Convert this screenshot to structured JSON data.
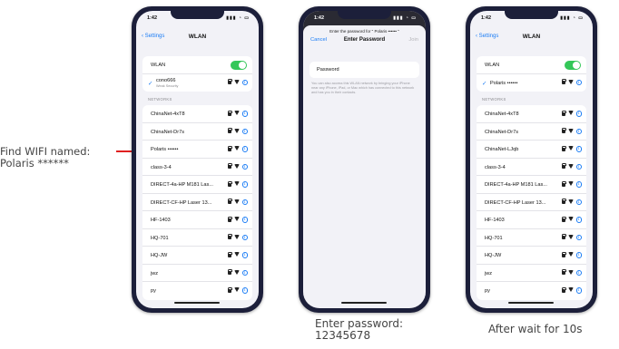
{
  "annotations": {
    "find_wifi": "Find WIFI named: Polaris ******",
    "enter_password": "Enter password: 12345678",
    "after_wait": "After wait for 10s"
  },
  "colors": {
    "accent": "#1a7cf5",
    "toggle_on": "#34c759",
    "arrow": "#e02020",
    "phone_frame": "#1c1f3a"
  },
  "phone1": {
    "time": "1:42",
    "back_label": "Settings",
    "title": "WLAN",
    "wlan_label": "WLAN",
    "connected": {
      "name": "cono666",
      "subtitle": "Weak Security"
    },
    "networks_header": "NETWORKS",
    "networks": [
      {
        "name": "ChinaNet-4xT8"
      },
      {
        "name": "ChinaNet-Dr7s"
      },
      {
        "name": "Polaris ••••••"
      },
      {
        "name": "class-3-4"
      },
      {
        "name": "DIRECT-4a-HP M181 Las..."
      },
      {
        "name": "DIRECT-CF-HP Laser 13..."
      },
      {
        "name": "HF-1403"
      },
      {
        "name": "HQ-701"
      },
      {
        "name": "HQ-JW"
      },
      {
        "name": "jwz"
      },
      {
        "name": "py"
      }
    ]
  },
  "phone2": {
    "time": "1:42",
    "prompt": "Enter the password for \" Polaris •••••• \"",
    "cancel": "Cancel",
    "title": "Enter Password",
    "join": "Join",
    "password_label": "Password",
    "hint": "You can also access this WLAN network by bringing your iPhone near any iPhone, iPad, or Mac which has connected to this network and has you in their contacts."
  },
  "phone3": {
    "time": "1:42",
    "back_label": "Settings",
    "title": "WLAN",
    "wlan_label": "WLAN",
    "connected": {
      "name": "Polaris ••••••"
    },
    "networks_header": "NETWORKS",
    "networks": [
      {
        "name": "ChinaNet-4xT8"
      },
      {
        "name": "ChinaNet-Dr7s"
      },
      {
        "name": "ChinaNet-LJqb"
      },
      {
        "name": "class-3-4"
      },
      {
        "name": "DIRECT-4a-HP M181 Las..."
      },
      {
        "name": "DIRECT-CF-HP Laser 13..."
      },
      {
        "name": "HF-1403"
      },
      {
        "name": "HQ-701"
      },
      {
        "name": "HQ-JW"
      },
      {
        "name": "jwz"
      },
      {
        "name": "py"
      }
    ]
  }
}
